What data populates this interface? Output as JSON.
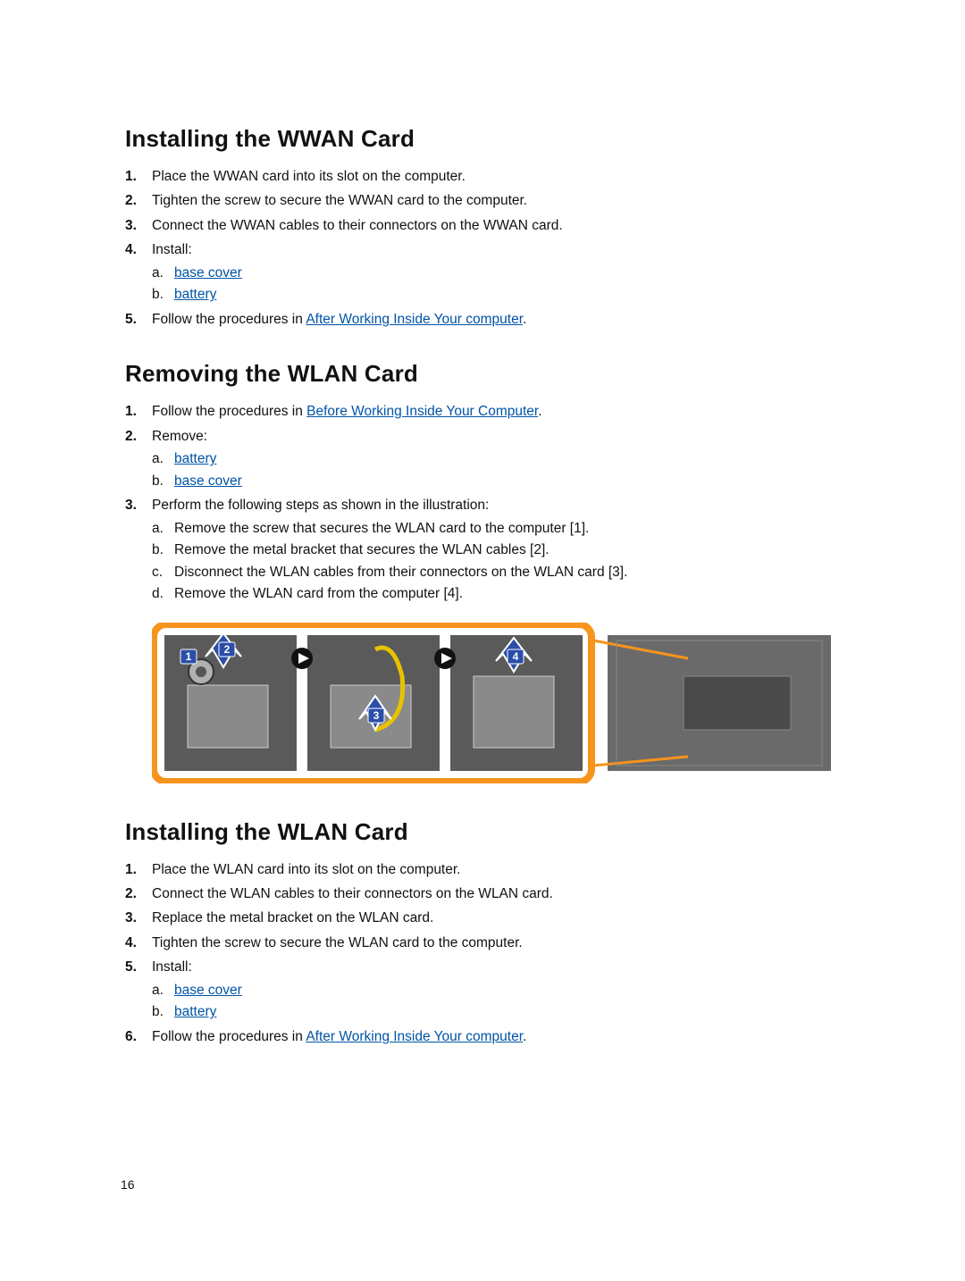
{
  "page_number": "16",
  "link_color": "#0054a6",
  "sections": {
    "wwan_install": {
      "heading": "Installing the WWAN Card",
      "steps": {
        "1": "Place the WWAN card into its slot on the computer.",
        "2": "Tighten the screw to secure the WWAN card to the computer.",
        "3": "Connect the WWAN cables to their connectors on the WWAN card.",
        "4": "Install:",
        "4a": "base cover",
        "4b": "battery",
        "5_pre": "Follow the procedures in ",
        "5_link": "After Working Inside Your computer",
        "5_post": "."
      }
    },
    "wlan_remove": {
      "heading": "Removing the WLAN Card",
      "steps": {
        "1_pre": "Follow the procedures in ",
        "1_link": "Before Working Inside Your Computer",
        "1_post": ".",
        "2": "Remove:",
        "2a": "battery",
        "2b": "base cover",
        "3": "Perform the following steps as shown in the illustration:",
        "3a": "Remove the screw that secures the WLAN card to the computer [1].",
        "3b": "Remove the metal bracket that secures the WLAN cables [2].",
        "3c": "Disconnect the WLAN cables from their connectors on the WLAN card [3].",
        "3d": "Remove the WLAN card from the computer [4]."
      }
    },
    "wlan_install": {
      "heading": "Installing the WLAN Card",
      "steps": {
        "1": "Place the WLAN card into its slot on the computer.",
        "2": "Connect the WLAN cables to their connectors on the WLAN card.",
        "3": "Replace the metal bracket on the WLAN card.",
        "4": "Tighten the screw to secure the WLAN card to the computer.",
        "5": "Install:",
        "5a": "base cover",
        "5b": "battery",
        "6_pre": "Follow the procedures in ",
        "6_link": "After Working Inside Your computer",
        "6_post": "."
      }
    }
  },
  "illustration": {
    "callouts": [
      "1",
      "2",
      "3",
      "4"
    ],
    "description": "Four-panel diagram showing WLAN card removal steps"
  }
}
